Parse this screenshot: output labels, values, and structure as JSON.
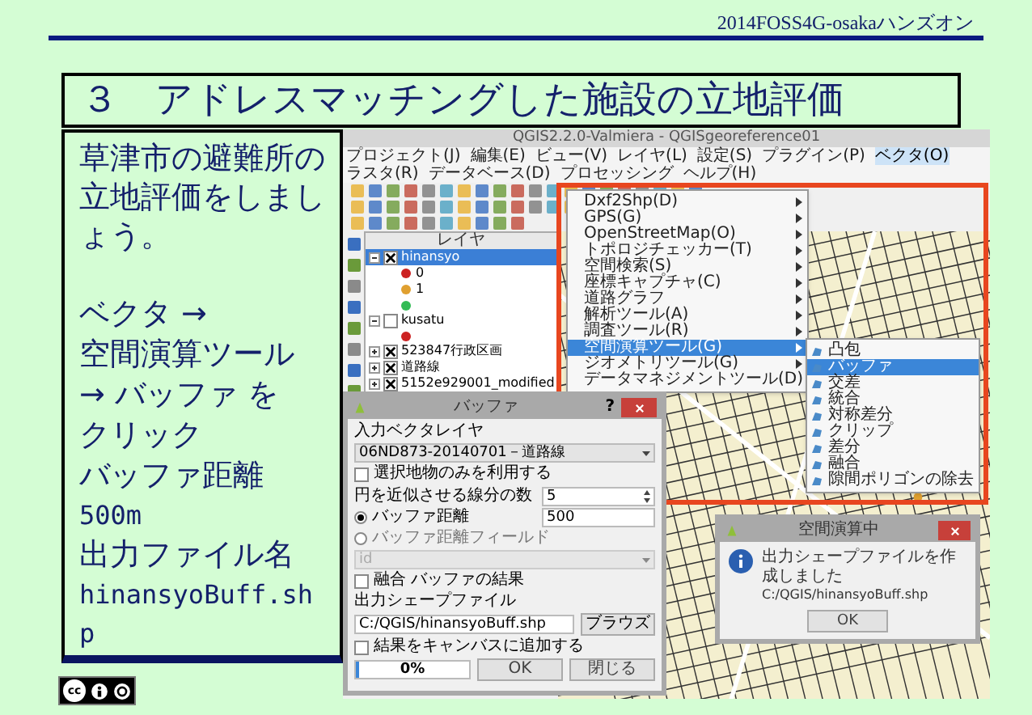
{
  "header": {
    "text": "2014FOSS4G-osakaハンズオン"
  },
  "title": "３　アドレスマッチングした施設の立地評価",
  "instructions": [
    {
      "kind": "lead",
      "text": "草津市の避難所の立地評価をしましょう。"
    },
    {
      "kind": "text",
      "text": "ベクタ →"
    },
    {
      "kind": "text",
      "text": "空間演算ツール → バッファ を"
    },
    {
      "kind": "text",
      "text": "クリック"
    },
    {
      "kind": "text",
      "text": "バッファ距離"
    },
    {
      "kind": "code",
      "text": "500m"
    },
    {
      "kind": "text",
      "text": "出力ファイル名"
    },
    {
      "kind": "code",
      "text": "hinansyoBuff.shp"
    }
  ],
  "qgis": {
    "title": "QGIS2.2.0-Valmiera - QGISgeoreference01",
    "menubar": [
      {
        "label": "プロジェクト(J)",
        "selected": false
      },
      {
        "label": "編集(E)",
        "selected": false
      },
      {
        "label": "ビュー(V)",
        "selected": false
      },
      {
        "label": "レイヤ(L)",
        "selected": false
      },
      {
        "label": "設定(S)",
        "selected": false
      },
      {
        "label": "プラグイン(P)",
        "selected": false
      },
      {
        "label": "ベクタ(O)",
        "selected": true
      },
      {
        "label": "ラスタ(R)",
        "selected": false
      },
      {
        "label": "データベース(D)",
        "selected": false
      },
      {
        "label": "プロセッシング",
        "selected": false
      },
      {
        "label": "ヘルプ(H)",
        "selected": false
      }
    ],
    "layers_panel": {
      "title": "レイヤ",
      "layers": [
        {
          "label": "hinansyo",
          "checked": true,
          "selected": true,
          "expanded": true,
          "children": [
            {
              "label": "0",
              "color": "#cc2222"
            },
            {
              "label": "1",
              "color": "#e0a030"
            },
            {
              "color": "#33bb55"
            }
          ]
        },
        {
          "label": "kusatu",
          "checked": false,
          "selected": false,
          "expanded": true,
          "children": [
            {
              "color": "#cc2222"
            }
          ]
        },
        {
          "label": "523847行政区画",
          "checked": true,
          "selected": false,
          "expanded": false
        },
        {
          "label": "道路線",
          "checked": true,
          "selected": false,
          "expanded": false
        },
        {
          "label": "5152e929001_modified",
          "checked": true,
          "selected": false,
          "expanded": false
        }
      ]
    },
    "vector_menu": [
      {
        "label": "Dxf2Shp(D)",
        "selected": false
      },
      {
        "label": "GPS(G)",
        "selected": false
      },
      {
        "label": "OpenStreetMap(O)",
        "selected": false
      },
      {
        "label": "トポロジチェッカー(T)",
        "selected": false
      },
      {
        "label": "空間検索(S)",
        "selected": false
      },
      {
        "label": "座標キャプチャ(C)",
        "selected": false
      },
      {
        "label": "道路グラフ",
        "selected": false
      },
      {
        "label": "解析ツール(A)",
        "selected": false
      },
      {
        "label": "調査ツール(R)",
        "selected": false
      },
      {
        "label": "空間演算ツール(G)",
        "selected": true
      },
      {
        "label": "ジオメトリツール(G)",
        "selected": false
      },
      {
        "label": "データマネジメントツール(D)",
        "selected": false
      }
    ],
    "geoprocessing_submenu": [
      {
        "label": "凸包",
        "selected": false
      },
      {
        "label": "バッファ",
        "selected": true
      },
      {
        "label": "交差",
        "selected": false
      },
      {
        "label": "統合",
        "selected": false
      },
      {
        "label": "対称差分",
        "selected": false
      },
      {
        "label": "クリップ",
        "selected": false
      },
      {
        "label": "差分",
        "selected": false
      },
      {
        "label": "融合",
        "selected": false
      },
      {
        "label": "隙間ポリゴンの除去",
        "selected": false
      }
    ]
  },
  "buffer_dialog": {
    "title": "バッファ",
    "help": "?",
    "input_layer_label": "入力ベクタレイヤ",
    "input_layer": "06ND873-20140701－道路線",
    "selected_only": {
      "label": "選択地物のみを利用する",
      "checked": false
    },
    "segments": {
      "label": "円を近似させる線分の数",
      "value": "5"
    },
    "distance_options": [
      {
        "label": "バッファ距離",
        "selected": true,
        "value": "500"
      },
      {
        "label": "バッファ距離フィールド",
        "selected": false
      }
    ],
    "field": {
      "value": "id",
      "disabled": true
    },
    "dissolve": {
      "label": "融合 バッファの結果",
      "checked": false
    },
    "output_label": "出力シェープファイル",
    "output_path": "C:/QGIS/hinansyoBuff.shp",
    "browse": "ブラウズ",
    "add_to_canvas": {
      "label": "結果をキャンバスに追加する",
      "checked": false
    },
    "progress": {
      "level": 0,
      "text": "0%"
    },
    "buttons": [
      "OK",
      "閉じる"
    ]
  },
  "message_dialog": {
    "title": "空間演算中",
    "text": "出力シェープファイルを作成しました",
    "path": "C:/QGIS/hinansyoBuff.shp",
    "button": "OK"
  },
  "license": {
    "logo": "cc"
  }
}
